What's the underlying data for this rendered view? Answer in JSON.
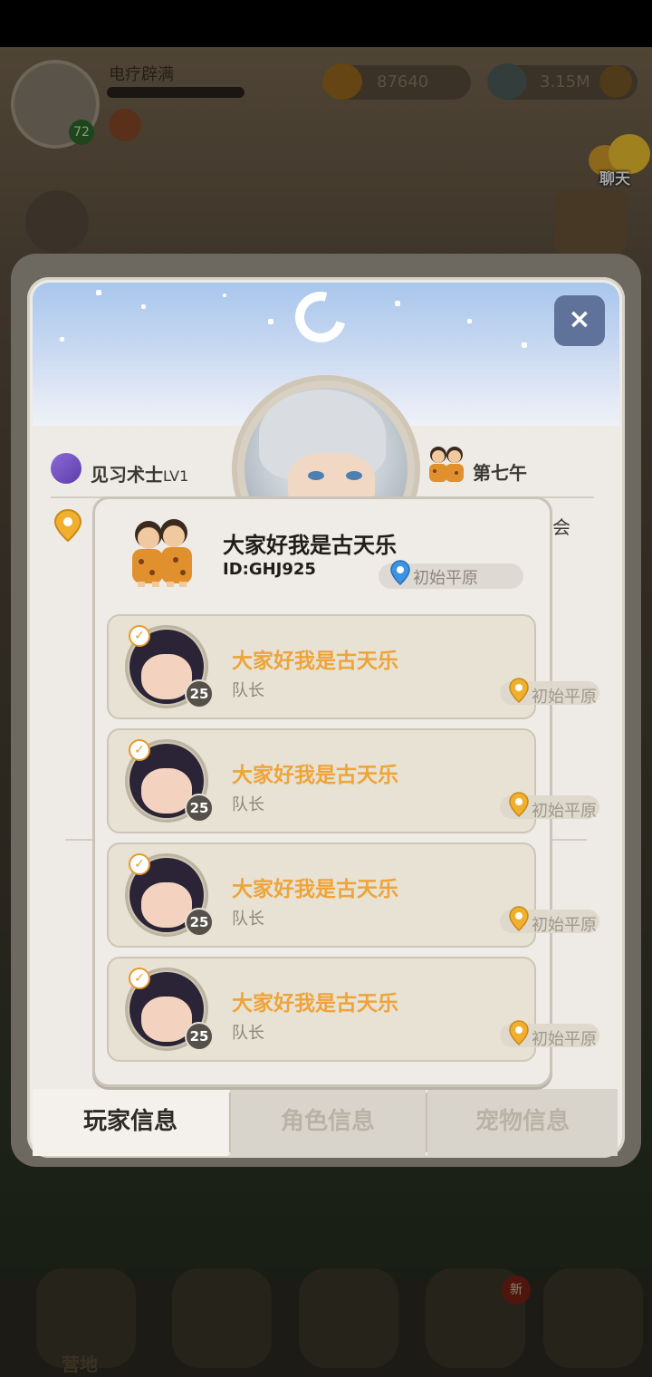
{
  "hud": {
    "player_name": "电疗辟满",
    "level": "72",
    "gold": "87640",
    "gems": "3.15M",
    "chat_label": "聊天"
  },
  "profile": {
    "class_name": "见习术士",
    "class_level": "LV1",
    "tribe": "第七午",
    "guild_suffix": "会",
    "close_symbol": "×"
  },
  "tabs": [
    {
      "label": "玩家信息"
    },
    {
      "label": "角色信息"
    },
    {
      "label": "宠物信息"
    }
  ],
  "team_popup": {
    "name": "大家好我是古天乐",
    "id": "ID:GHJ925",
    "location": "初始平原",
    "members": [
      {
        "name": "大家好我是古天乐",
        "role": "队长",
        "level": "25",
        "location": "初始平原"
      },
      {
        "name": "大家好我是古天乐",
        "role": "队长",
        "level": "25",
        "location": "初始平原"
      },
      {
        "name": "大家好我是古天乐",
        "role": "队长",
        "level": "25",
        "location": "初始平原"
      },
      {
        "name": "大家好我是古天乐",
        "role": "队长",
        "level": "25",
        "location": "初始平原"
      }
    ]
  },
  "bottom_nav": {
    "camp_label": "营地",
    "new_badge": "新"
  },
  "colors": {
    "accent_gold": "#eea43a",
    "close_button": "#5f7299",
    "panel_bg": "#eeebe6"
  }
}
